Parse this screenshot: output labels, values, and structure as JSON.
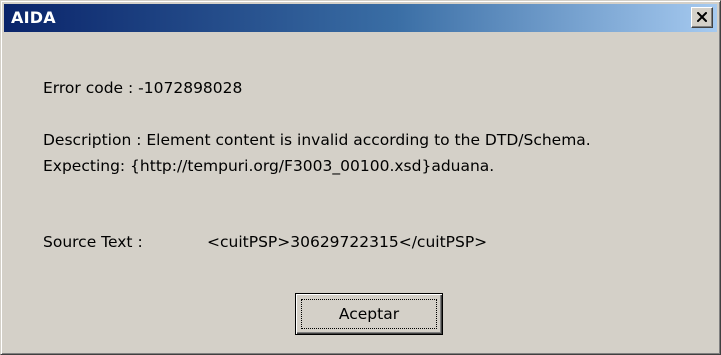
{
  "window": {
    "title": "AIDA",
    "close_symbol": "close-icon"
  },
  "message": {
    "error_code": "Error code : -1072898028",
    "description_line1": "Description : Element content is invalid according to the DTD/Schema.",
    "description_line2": "Expecting: {http://tempuri.org/F3003_00100.xsd}aduana.",
    "source_label": "Source Text :",
    "source_value": "<cuitPSP>30629722315</cuitPSP>"
  },
  "buttons": {
    "ok_label": "Aceptar"
  },
  "colors": {
    "title_gradient_start": "#0a246a",
    "title_gradient_end": "#a6caf0",
    "face": "#d4d0c8"
  }
}
